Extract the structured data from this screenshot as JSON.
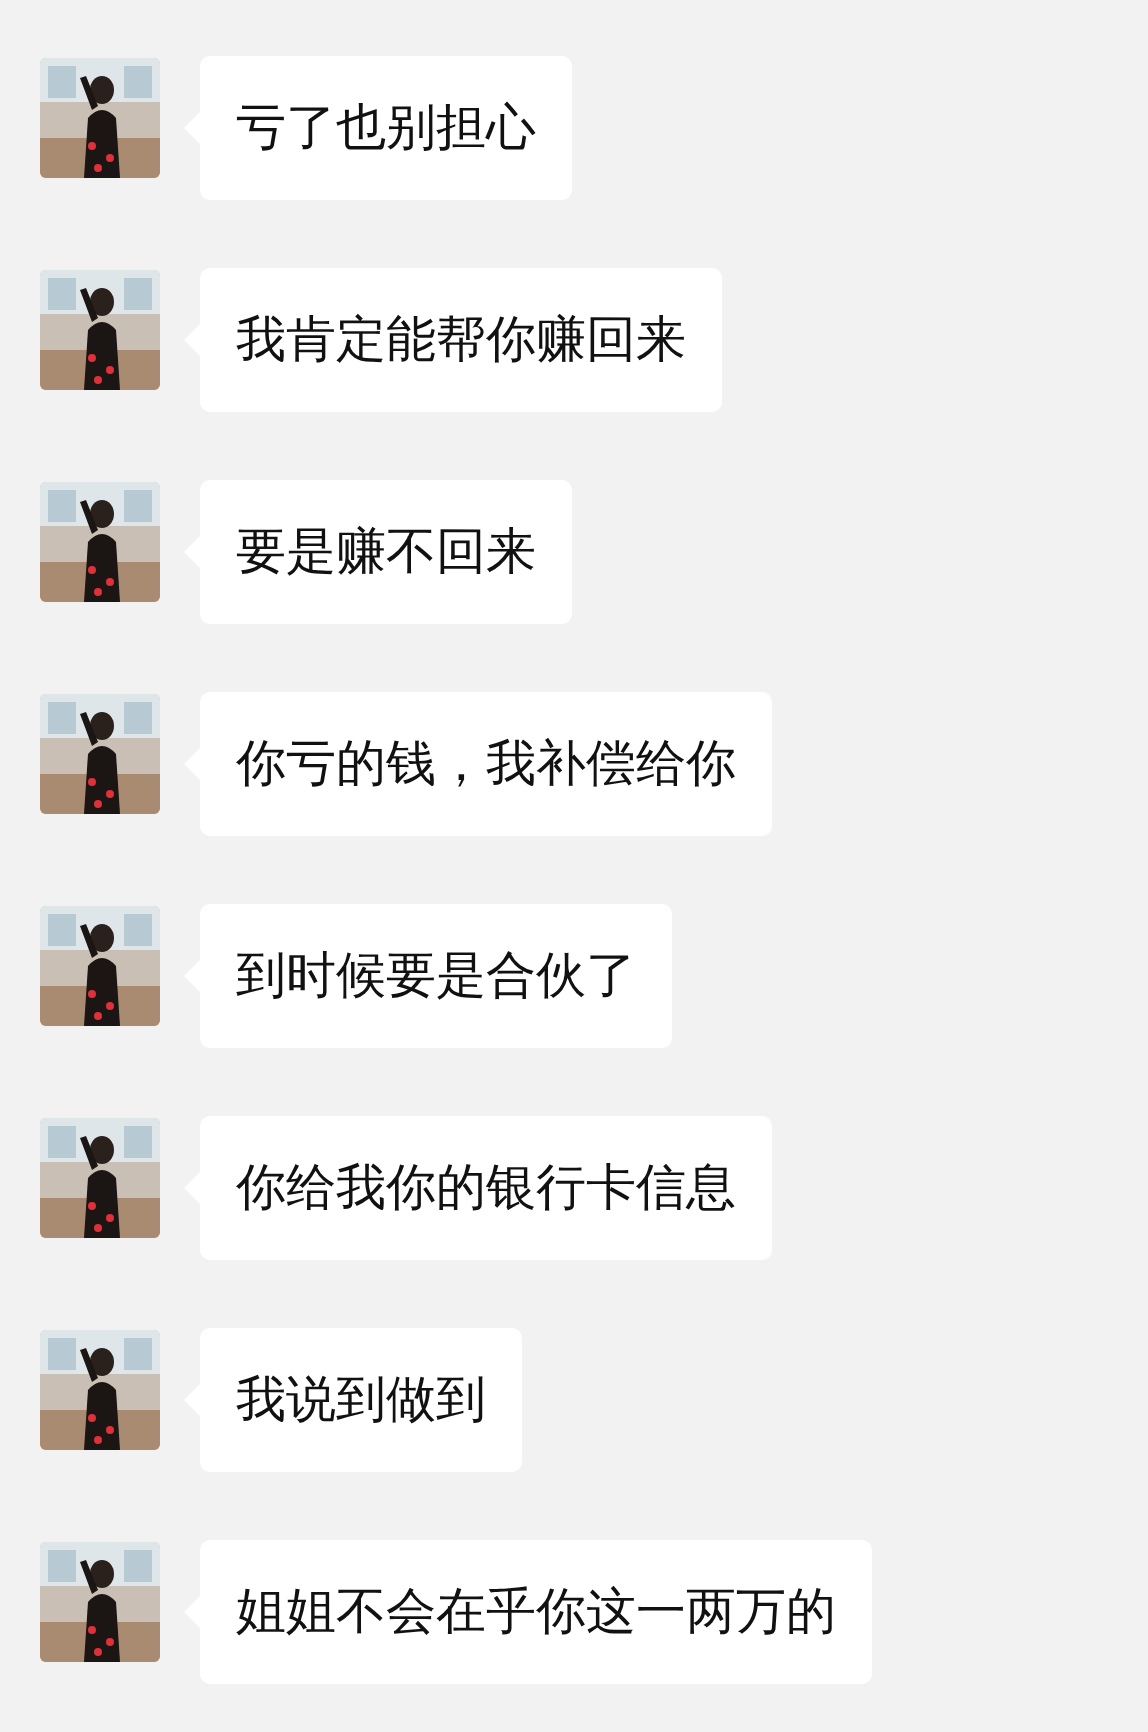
{
  "messages": [
    {
      "text": "亏了也别担心"
    },
    {
      "text": "我肯定能帮你赚回来"
    },
    {
      "text": "要是赚不回来"
    },
    {
      "text": "你亏的钱，我补偿给你"
    },
    {
      "text": "到时候要是合伙了"
    },
    {
      "text": "你给我你的银行卡信息"
    },
    {
      "text": "我说到做到"
    },
    {
      "text": "姐姐不会在乎你这一两万的"
    }
  ]
}
